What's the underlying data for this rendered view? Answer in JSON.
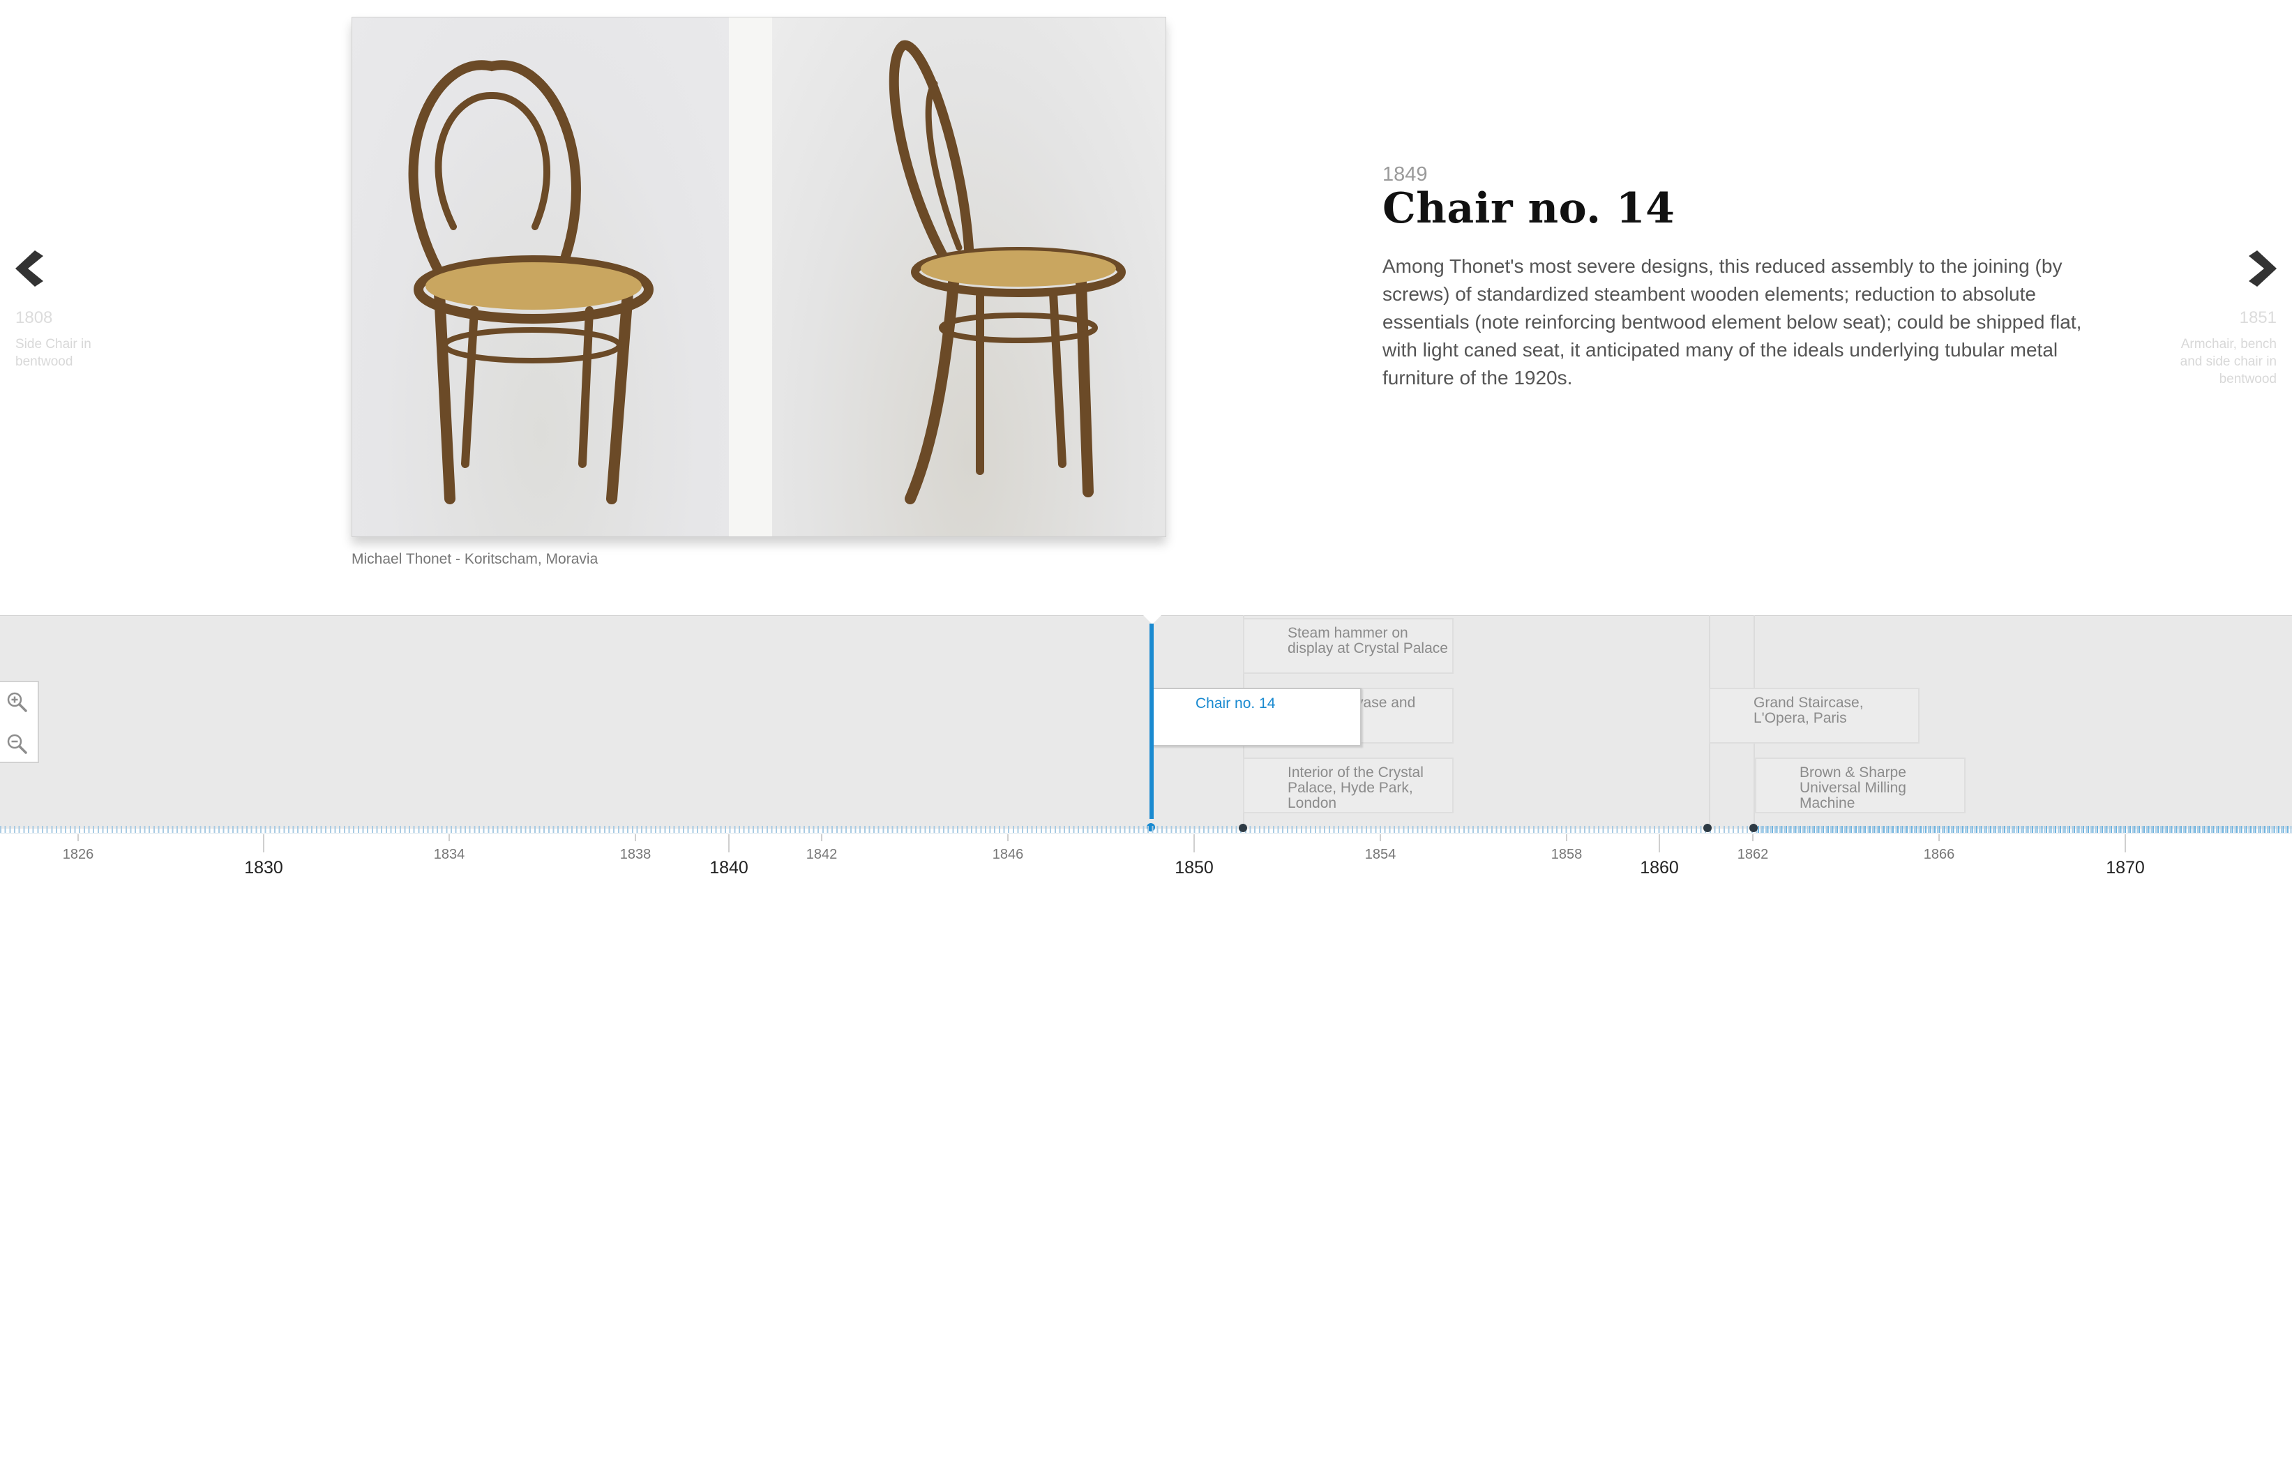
{
  "slide": {
    "date": "1849",
    "title": "Chair no. 14",
    "description": "Among Thonet's most severe designs, this reduced assembly to the joining (by screws) of standardized steambent wooden elements; reduction to absolute essentials (note reinforcing bentwood element below seat); could be shipped flat, with light caned seat, it anticipated many of the ideals underlying tubular metal furniture of the 1920s.",
    "caption": "Michael Thonet - Koritscham, Moravia"
  },
  "nav": {
    "prev": {
      "date": "1808",
      "title": "Side Chair in bentwood"
    },
    "next": {
      "date": "1851",
      "title": "Armchair, bench and side chair in bentwood"
    }
  },
  "timeline": {
    "events": [
      {
        "label": "Steam hammer on display at Crystal Palace"
      },
      {
        "label": "Chair no. 14"
      },
      {
        "label": "Footstool, vase and"
      },
      {
        "label": "Interior of the Crystal Palace, Hyde Park, London"
      },
      {
        "label": "Grand Staircase, L'Opera, Paris"
      },
      {
        "label": "Brown & Sharpe Universal Milling Machine"
      }
    ],
    "years_minor": [
      "1826",
      "1834",
      "1838",
      "1842",
      "1846",
      "1854",
      "1858",
      "1862",
      "1866"
    ],
    "years_major": [
      "1830",
      "1840",
      "1850",
      "1860",
      "1870"
    ]
  },
  "colors": {
    "accent": "#1a8ad0",
    "timeline_bg": "#e9e9e9"
  },
  "icons": {
    "prev": "chevron-left-icon",
    "next": "chevron-right-icon",
    "zoom_in": "zoom-in-icon",
    "zoom_out": "zoom-out-icon"
  }
}
